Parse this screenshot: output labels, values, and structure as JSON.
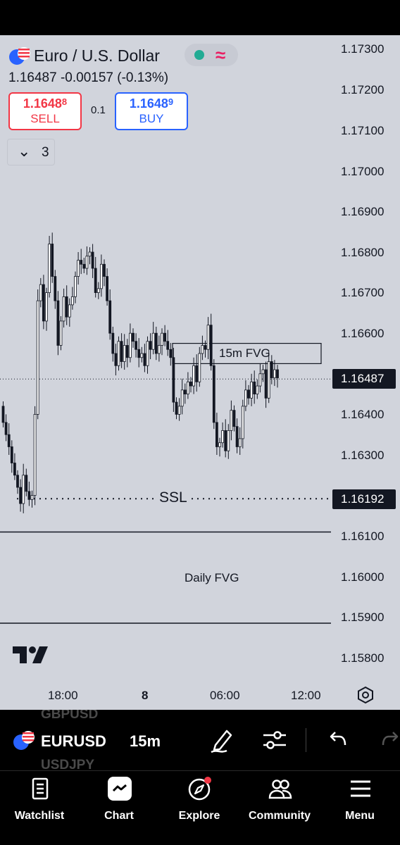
{
  "header": {
    "title": "Euro / U.S. Dollar",
    "price_line": "1.16487  -0.00157 (-0.13%)",
    "sell": {
      "price_main": "1.1648",
      "price_sup": "8",
      "label": "SELL"
    },
    "buy": {
      "price_main": "1.1648",
      "price_sup": "9",
      "label": "BUY"
    },
    "quantity": "0.1",
    "collapsed_count": "3"
  },
  "colors": {
    "background": "#d1d4dc",
    "sell": "#f23645",
    "buy": "#2962ff",
    "market_open": "#22ab94",
    "wave": "#e91e63"
  },
  "price_axis": [
    "1.17300",
    "1.17200",
    "1.17100",
    "1.17000",
    "1.16900",
    "1.16800",
    "1.16700",
    "1.16600",
    "1.16500",
    "1.16400",
    "1.16300",
    "1.16200",
    "1.16100",
    "1.16000",
    "1.15900",
    "1.15800"
  ],
  "price_tags": {
    "current": "1.16487",
    "ssl": "1.16192"
  },
  "time_axis": [
    "18:00",
    "8",
    "06:00",
    "12:00"
  ],
  "annotations": {
    "fvg_15m": "15m FVG",
    "ssl": "SSL",
    "daily_fvg": "Daily FVG"
  },
  "toolbar": {
    "symbol": "EURUSD",
    "timeframe": "15m",
    "ghost_above": "GBPUSD",
    "ghost_below": "USDJPY"
  },
  "nav": [
    "Watchlist",
    "Chart",
    "Explore",
    "Community",
    "Menu"
  ],
  "chart_data": {
    "type": "candlestick",
    "symbol": "EURUSD",
    "interval": "15m",
    "ylim": [
      1.1575,
      1.1735
    ],
    "current_price": 1.16487,
    "levels": [
      {
        "name": "SSL",
        "price": 1.16192,
        "style": "dotted"
      },
      {
        "name": "Daily FVG",
        "price_top": 1.1611,
        "price_bottom": 1.15885
      },
      {
        "name": "15m FVG",
        "price_top": 1.16575,
        "price_bottom": 1.16525
      }
    ],
    "closes": [
      1.1638,
      1.1635,
      1.1632,
      1.1628,
      1.1625,
      1.1622,
      1.1618,
      1.1625,
      1.1621,
      1.1619,
      1.162,
      1.164,
      1.1668,
      1.1672,
      1.1663,
      1.167,
      1.1682,
      1.1674,
      1.1668,
      1.1657,
      1.1663,
      1.1669,
      1.1664,
      1.1667,
      1.1669,
      1.1674,
      1.1678,
      1.1677,
      1.1676,
      1.1679,
      1.168,
      1.1676,
      1.167,
      1.1671,
      1.1677,
      1.1674,
      1.1668,
      1.166,
      1.1655,
      1.1652,
      1.1658,
      1.1653,
      1.1657,
      1.1654,
      1.166,
      1.1658,
      1.1656,
      1.1654,
      1.1655,
      1.1652,
      1.1658,
      1.1656,
      1.166,
      1.1655,
      1.1657,
      1.166,
      1.1658,
      1.1656,
      1.1654,
      1.1643,
      1.164,
      1.1642,
      1.1646,
      1.1645,
      1.1648,
      1.1647,
      1.1652,
      1.1648,
      1.1655,
      1.1657,
      1.1656,
      1.1662,
      1.1652,
      1.1638,
      1.1632,
      1.1633,
      1.1636,
      1.1631,
      1.1636,
      1.1641,
      1.1637,
      1.1632,
      1.1634,
      1.1642,
      1.1646,
      1.1644,
      1.1648,
      1.1645,
      1.1647,
      1.165,
      1.1651,
      1.1644,
      1.1653,
      1.1649,
      1.1651,
      1.1649
    ]
  }
}
